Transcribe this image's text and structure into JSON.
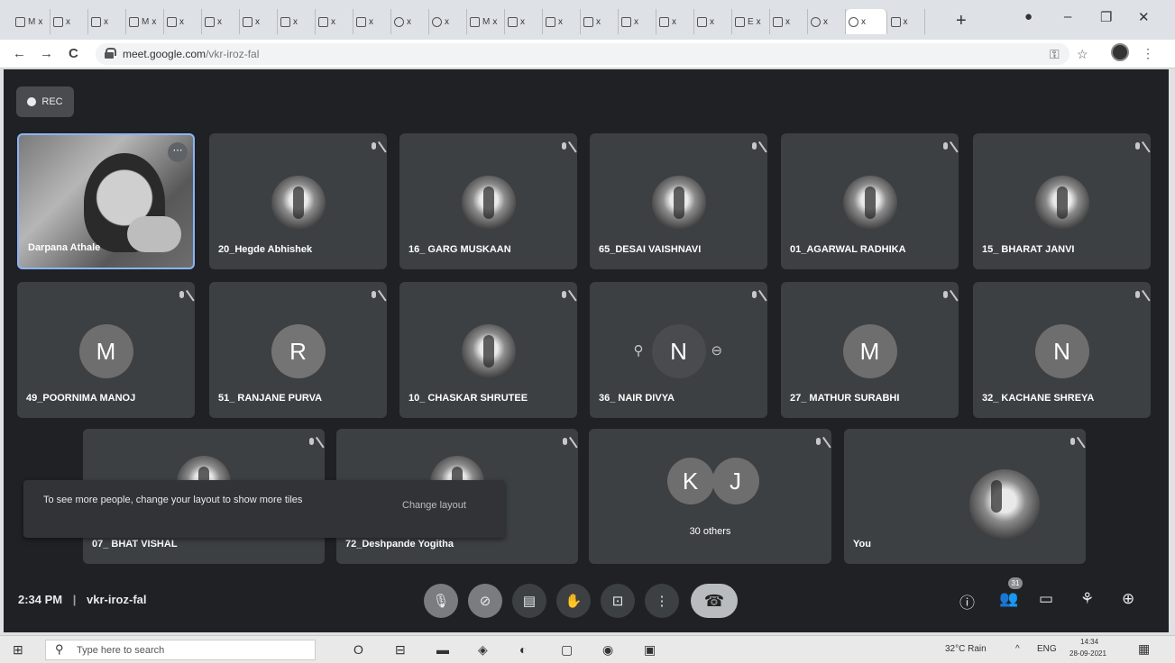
{
  "browser": {
    "tabs": [
      {
        "label": "M",
        "x": "x",
        "icon": "gmail-icon"
      },
      {
        "label": "",
        "x": "x",
        "icon": "drive-icon"
      },
      {
        "label": "",
        "x": "x",
        "icon": "doc-icon"
      },
      {
        "label": "M",
        "x": "x",
        "icon": "gmail-icon"
      },
      {
        "label": "",
        "x": "x",
        "icon": "link-icon"
      },
      {
        "label": "",
        "x": "x",
        "icon": "doc-icon"
      },
      {
        "label": "",
        "x": "x",
        "icon": "doc-icon"
      },
      {
        "label": "",
        "x": "x",
        "icon": "file-icon"
      },
      {
        "label": "",
        "x": "x",
        "icon": "doc-icon"
      },
      {
        "label": "",
        "x": "x",
        "icon": "file-icon"
      },
      {
        "label": "",
        "x": "x",
        "icon": "globe-icon"
      },
      {
        "label": "",
        "x": "x",
        "icon": "globe-icon"
      },
      {
        "label": "M",
        "x": "x",
        "icon": "gmail-icon"
      },
      {
        "label": "",
        "x": "x",
        "icon": "doc-icon"
      },
      {
        "label": "",
        "x": "x",
        "icon": "doc-icon"
      },
      {
        "label": "",
        "x": "x",
        "icon": "file-icon"
      },
      {
        "label": "",
        "x": "x",
        "icon": "file-icon"
      },
      {
        "label": "",
        "x": "x",
        "icon": "doc-icon"
      },
      {
        "label": "",
        "x": "x",
        "icon": "doc-icon"
      },
      {
        "label": "E",
        "x": "x",
        "icon": "edit-icon"
      },
      {
        "label": "",
        "x": "x",
        "icon": "file-icon"
      },
      {
        "label": "",
        "x": "x",
        "icon": "globe-icon"
      },
      {
        "label": "",
        "x": "x",
        "icon": "meet-icon",
        "active": true
      },
      {
        "label": "",
        "x": "x",
        "icon": "file-icon"
      }
    ],
    "newtab": "+",
    "window": {
      "minimize": "–",
      "maximize": "❐",
      "close": "✕"
    },
    "back": "←",
    "forward": "→",
    "reload": "C",
    "url_host": "meet.google.com",
    "url_path": "/vkr-iroz-fal"
  },
  "meet": {
    "rec_label": "REC",
    "participants": [
      {
        "name": "Darpana Athale",
        "kind": "video"
      },
      {
        "name": "20_Hegde Abhishek",
        "kind": "photo"
      },
      {
        "name": "16_ GARG MUSKAAN",
        "kind": "photo"
      },
      {
        "name": "65_DESAI VAISHNAVI",
        "kind": "photo"
      },
      {
        "name": "01_AGARWAL RADHIKA",
        "kind": "photo"
      },
      {
        "name": "15_ BHARAT JANVI",
        "kind": "photo"
      },
      {
        "name": "49_POORNIMA MANOJ",
        "kind": "letter",
        "letter": "M",
        "color": "#6e6e6e"
      },
      {
        "name": "51_ RANJANE PURVA",
        "kind": "letter",
        "letter": "R",
        "color": "#747474"
      },
      {
        "name": "10_ CHASKAR SHRUTEE",
        "kind": "photo"
      },
      {
        "name": "36_ NAIR DIVYA",
        "kind": "letter",
        "letter": "N",
        "color": "#4a4b4e"
      },
      {
        "name": "27_ MATHUR SURABHI",
        "kind": "letter",
        "letter": "M",
        "color": "#6e6e6e"
      },
      {
        "name": "32_ KACHANE SHREYA",
        "kind": "letter",
        "letter": "N",
        "color": "#6e6e6e"
      },
      {
        "name": "07_ BHAT VISHAL",
        "kind": "photo"
      },
      {
        "name": "72_Deshpande Yogitha",
        "kind": "photo"
      },
      {
        "name": "30 others",
        "kind": "others",
        "letters": [
          "K",
          "J"
        ]
      },
      {
        "name": "You",
        "kind": "photo"
      }
    ],
    "toast": {
      "message": "To see more people, change your layout to show more tiles",
      "action": "Change layout"
    },
    "clock": "2:34 PM",
    "separator": "|",
    "meeting_code": "vkr-iroz-fal",
    "controls": {
      "mic": "🎙",
      "camera": "⊘",
      "captions": "▤",
      "raise_hand": "✋",
      "present": "⊡",
      "more": "⋮",
      "end": "☎"
    },
    "people_count": "31",
    "right_icons": {
      "info": "ⓘ",
      "people": "👥",
      "chat": "▭",
      "activities": "⚘",
      "host": "⊕"
    }
  },
  "taskbar": {
    "start": "⊞",
    "search_placeholder": "Type here to search",
    "search_glyph": "⚲",
    "apps": [
      "O",
      "⊟",
      "▬",
      "◈",
      "◐",
      "▢",
      "◉",
      "▣"
    ],
    "weather": "32°C Rain",
    "chevron": "^",
    "lang": "ENG",
    "time": "14:34",
    "date": "28-09-2021",
    "notif": "▦"
  }
}
